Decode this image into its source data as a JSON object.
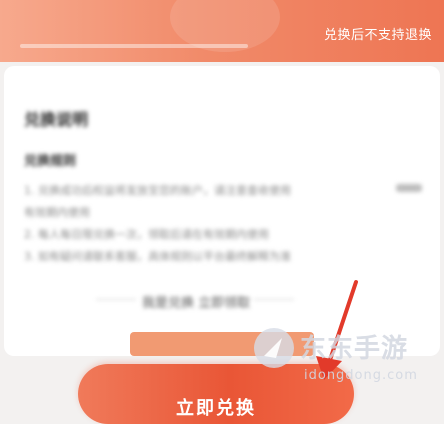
{
  "banner": {
    "notice": "兑换后不支持退换"
  },
  "card": {
    "title": "兑换说明",
    "subtitle": "兑换规则",
    "rules": [
      "1. 兑换成功后权益将发放至您的账户，请注意查收使用",
      "有效期内使用",
      "2. 每人每日限兑换一次，领取后请在有效期内使用",
      "3. 如有疑问请联系客服，具体规则以平台最终解释为准"
    ],
    "center_text": "我是兑换 立即领取"
  },
  "cta": {
    "label": "立即兑换"
  },
  "watermark": {
    "title": "东东手游",
    "url": "idongdong.com"
  },
  "colors": {
    "accent": "#e95636",
    "banner": "#f18b6a",
    "arrow": "#e23a2a"
  }
}
